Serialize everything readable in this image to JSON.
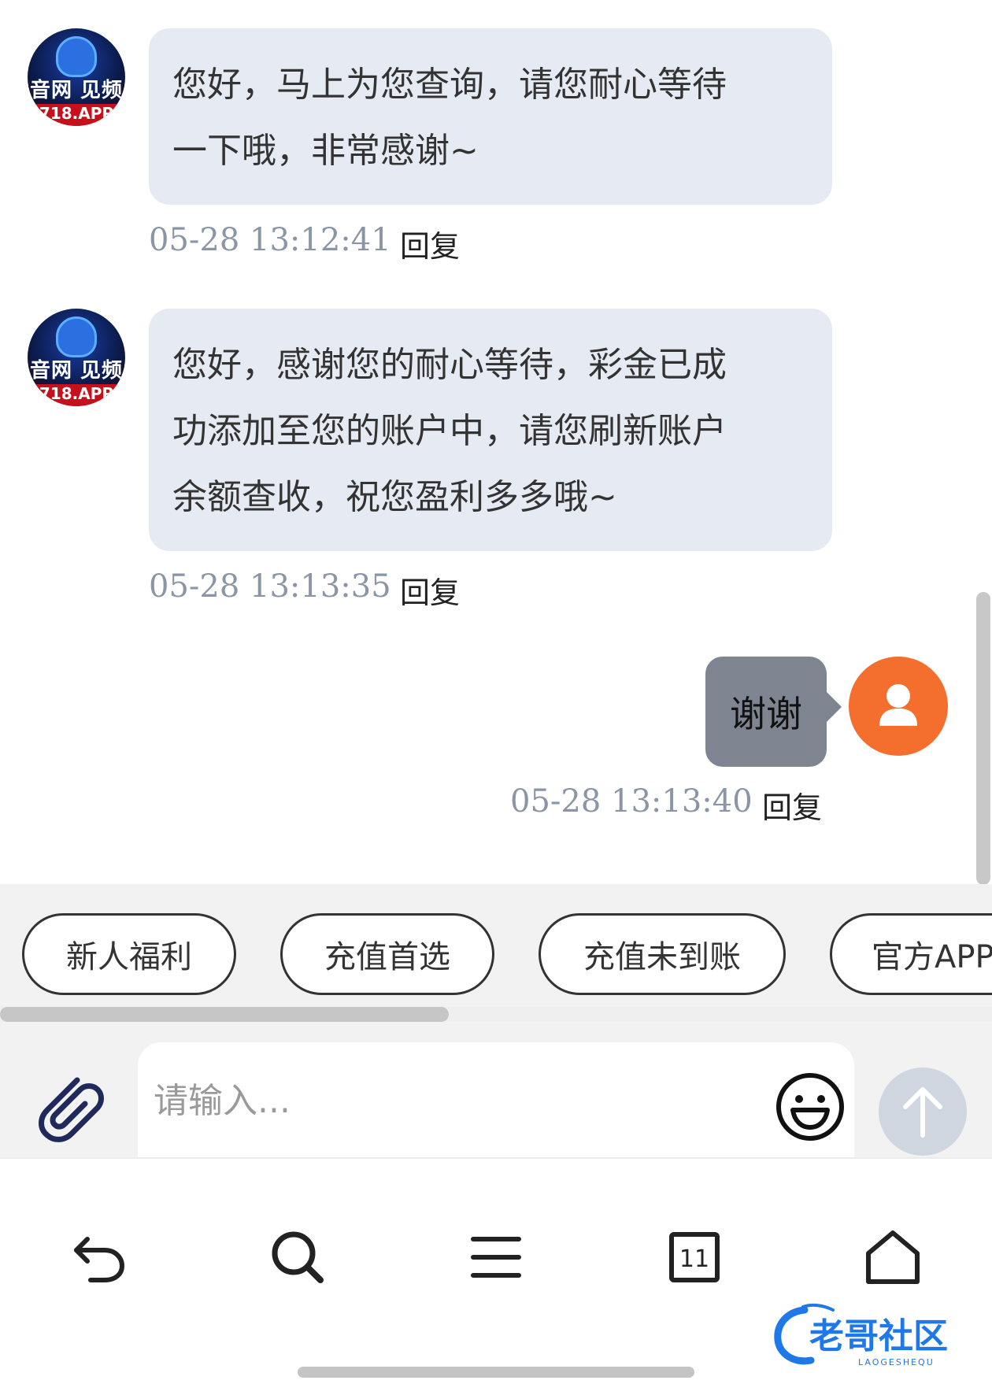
{
  "messages": [
    {
      "sender": "agent",
      "avatar_text": "音网 见频",
      "avatar_sub": "718.APP",
      "lines": [
        "您好，马上为您查询，请您耐心等待",
        "一下哦，非常感谢~"
      ],
      "time": "05-28 13:12:41",
      "reply": "回复"
    },
    {
      "sender": "agent",
      "avatar_text": "音网 见频",
      "avatar_sub": "718.APP",
      "lines": [
        "您好，感谢您的耐心等待，彩金已成",
        "功添加至您的账户中，请您刷新账户",
        "余额查收，祝您盈利多多哦~"
      ],
      "time": "05-28 13:13:35",
      "reply": "回复"
    },
    {
      "sender": "user",
      "text": "谢谢",
      "time": "05-28 13:13:40",
      "reply": "回复"
    }
  ],
  "quick_replies": [
    "新人福利",
    "充值首选",
    "充值未到账",
    "官方APP"
  ],
  "input": {
    "placeholder": "请输入..."
  },
  "icons": {
    "attach": "paperclip-icon",
    "emoji": "smiley-icon",
    "send": "arrow-up-icon",
    "nav": [
      "back-icon",
      "search-icon",
      "menu-icon",
      "tabs-icon",
      "home-icon"
    ]
  },
  "tabs_count": "11",
  "watermark": {
    "text": "老哥社区",
    "sub": "LAOGESHEQU"
  },
  "colors": {
    "agent_bubble": "#e6ebf3",
    "user_bubble": "#7e8590",
    "user_avatar": "#f46f2e",
    "time_text": "#8a95a5",
    "send_button": "#cfd6e0",
    "watermark_blue": "#1e78e8"
  }
}
